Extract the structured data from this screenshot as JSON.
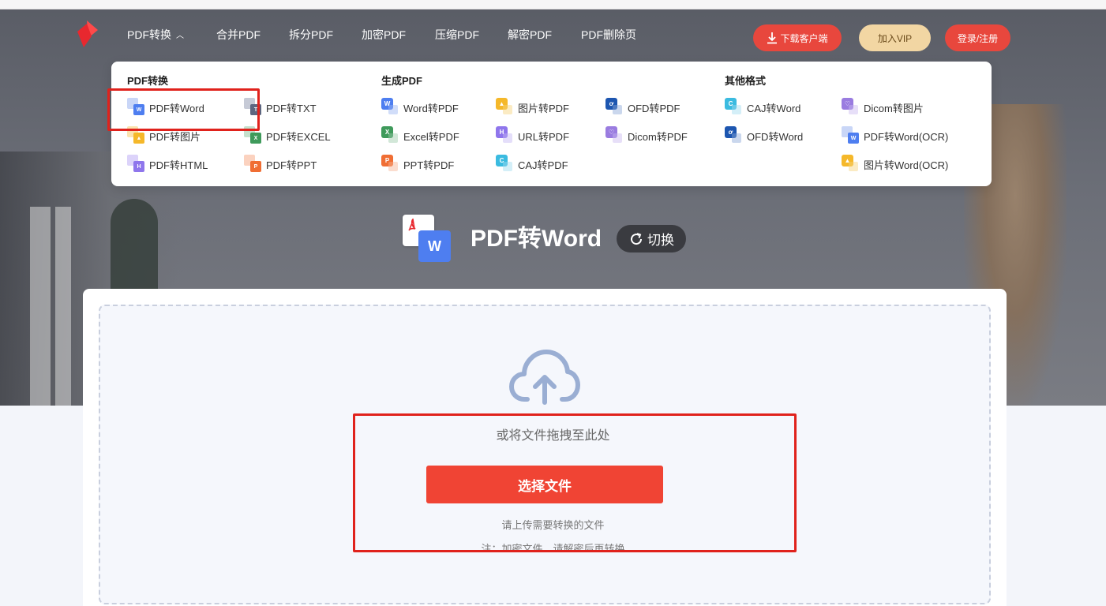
{
  "nav": {
    "items": [
      "PDF转换",
      "合并PDF",
      "拆分PDF",
      "加密PDF",
      "压缩PDF",
      "解密PDF",
      "PDF删除页"
    ],
    "download_label": "下载客户端",
    "vip_label": "加入VIP",
    "login_label": "登录/注册"
  },
  "menu": {
    "sections": [
      {
        "title": "PDF转换",
        "items": [
          "PDF转Word",
          "PDF转TXT",
          "PDF转图片",
          "PDF转EXCEL",
          "PDF转HTML",
          "PDF转PPT"
        ]
      },
      {
        "title": "生成PDF",
        "items": [
          "Word转PDF",
          "图片转PDF",
          "OFD转PDF",
          "Excel转PDF",
          "URL转PDF",
          "Dicom转PDF",
          "PPT转PDF",
          "CAJ转PDF"
        ]
      },
      {
        "title": "其他格式",
        "items": [
          "CAJ转Word",
          "Dicom转图片",
          "OFD转Word",
          "PDF转Word(OCR)",
          "图片转Word(OCR)"
        ]
      }
    ],
    "icons": {
      "word": "#4e7ef0",
      "txt": "#5d6680",
      "image": "#f5b82a",
      "excel": "#3f9a5b",
      "html": "#8f76ec",
      "ppt": "#f06e34",
      "ofd": "#1d56b0",
      "caj": "#3bbbe0",
      "dicom": "#9a7ce0"
    }
  },
  "title": {
    "text": "PDF转Word",
    "switch_label": "切换"
  },
  "upload": {
    "drop_text": "或将文件拖拽至此处",
    "select_label": "选择文件",
    "hint": "请上传需要转换的文件",
    "note": "注：加密文件，请解密后再转换"
  },
  "colors": {
    "accent": "#f04434",
    "annotation": "#e0221c"
  }
}
